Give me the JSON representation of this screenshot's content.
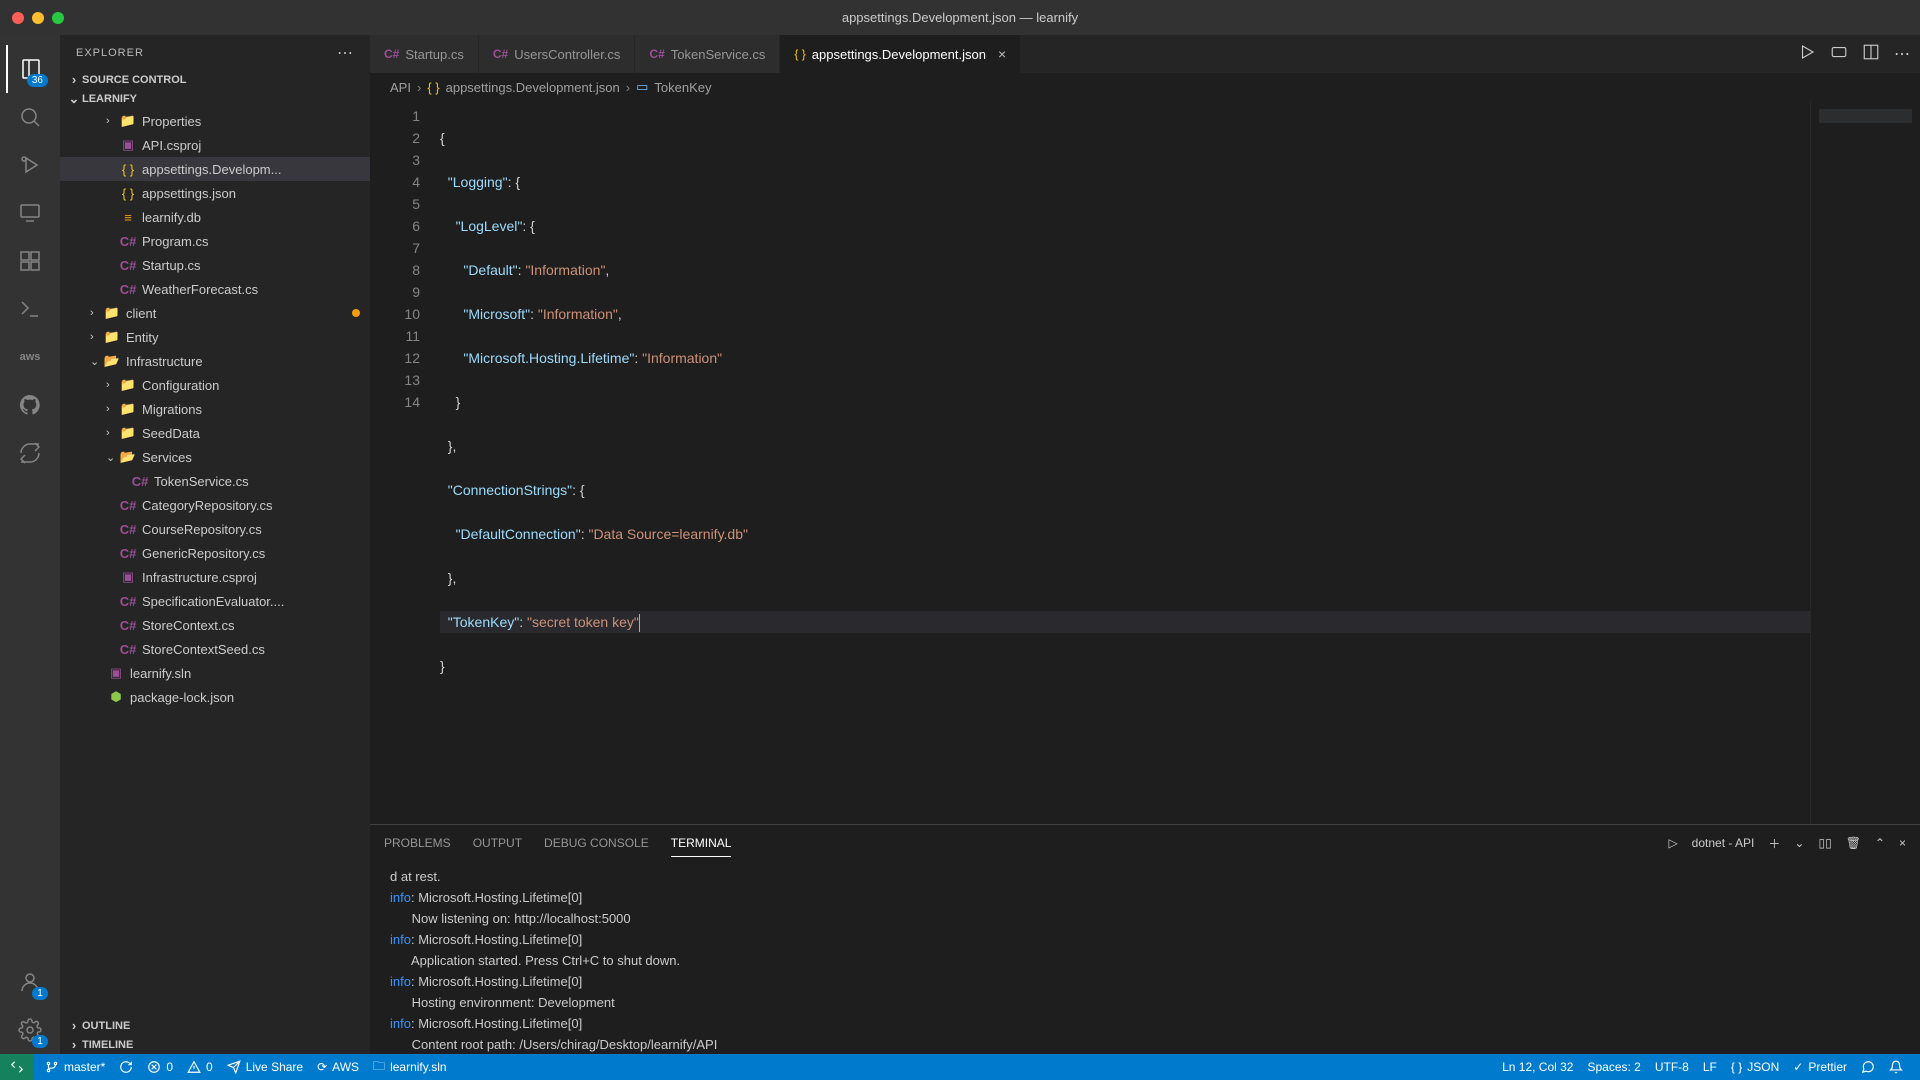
{
  "window": {
    "title": "appsettings.Development.json — learnify"
  },
  "activitybar": {
    "explorer_badge": "36",
    "accounts_badge": "1",
    "settings_badge": "1"
  },
  "sidebar": {
    "header": "EXPLORER",
    "sections": {
      "source_control": "SOURCE CONTROL",
      "folder": "LEARNIFY",
      "outline": "OUTLINE",
      "timeline": "TIMELINE"
    },
    "tree": {
      "properties": "Properties",
      "api_csproj": "API.csproj",
      "appsettings_dev": "appsettings.Developm...",
      "appsettings": "appsettings.json",
      "learnify_db": "learnify.db",
      "program": "Program.cs",
      "startup": "Startup.cs",
      "weather": "WeatherForecast.cs",
      "client": "client",
      "entity": "Entity",
      "infrastructure": "Infrastructure",
      "configuration": "Configuration",
      "migrations": "Migrations",
      "seeddata": "SeedData",
      "services": "Services",
      "tokenservice": "TokenService.cs",
      "categoryrepo": "CategoryRepository.cs",
      "courserepo": "CourseRepository.cs",
      "genericrepo": "GenericRepository.cs",
      "infra_csproj": "Infrastructure.csproj",
      "speceval": "SpecificationEvaluator....",
      "storecontext": "StoreContext.cs",
      "storeseed": "StoreContextSeed.cs",
      "learnify_sln": "learnify.sln",
      "packagelock": "package-lock.json"
    }
  },
  "tabs": [
    {
      "icon": "C#",
      "label": "Startup.cs"
    },
    {
      "icon": "C#",
      "label": "UsersController.cs"
    },
    {
      "icon": "C#",
      "label": "TokenService.cs"
    },
    {
      "icon": "{ }",
      "label": "appsettings.Development.json"
    }
  ],
  "breadcrumbs": {
    "p1": "API",
    "p2": "appsettings.Development.json",
    "p3": "TokenKey"
  },
  "code": {
    "lines": [
      "1",
      "2",
      "3",
      "4",
      "5",
      "6",
      "7",
      "8",
      "9",
      "10",
      "11",
      "12",
      "13",
      "14"
    ],
    "l1k": "\"Logging\"",
    "l2k": "\"LogLevel\"",
    "l3k": "\"Default\"",
    "l3v": "\"Information\"",
    "l4k": "\"Microsoft\"",
    "l4v": "\"Information\"",
    "l5k": "\"Microsoft.Hosting.Lifetime\"",
    "l5v": "\"Information\"",
    "l6k": "\"ConnectionStrings\"",
    "l7k": "\"DefaultConnection\"",
    "l7v": "\"Data Source=learnify.db\"",
    "l8k": "\"TokenKey\"",
    "l8v": "\"secret token key\""
  },
  "panel": {
    "tabs": {
      "problems": "PROBLEMS",
      "output": "OUTPUT",
      "debug": "DEBUG CONSOLE",
      "terminal": "TERMINAL"
    },
    "termlabel": "dotnet - API",
    "term_l0": "d at rest.",
    "info": "info",
    "term_l1": ": Microsoft.Hosting.Lifetime[0]",
    "term_l2": "      Now listening on: http://localhost:5000",
    "term_l3": ": Microsoft.Hosting.Lifetime[0]",
    "term_l4": "      Application started. Press Ctrl+C to shut down.",
    "term_l5": ": Microsoft.Hosting.Lifetime[0]",
    "term_l6": "      Hosting environment: Development",
    "term_l7": ": Microsoft.Hosting.Lifetime[0]",
    "term_l8": "      Content root path: /Users/chirag/Desktop/learnify/API"
  },
  "status": {
    "branch": "master*",
    "errors": "0",
    "warnings": "0",
    "liveshare": "Live Share",
    "aws": "AWS",
    "sln": "learnify.sln",
    "lncol": "Ln 12, Col 32",
    "spaces": "Spaces: 2",
    "enc": "UTF-8",
    "eol": "LF",
    "lang": "JSON",
    "prettier": "Prettier"
  }
}
